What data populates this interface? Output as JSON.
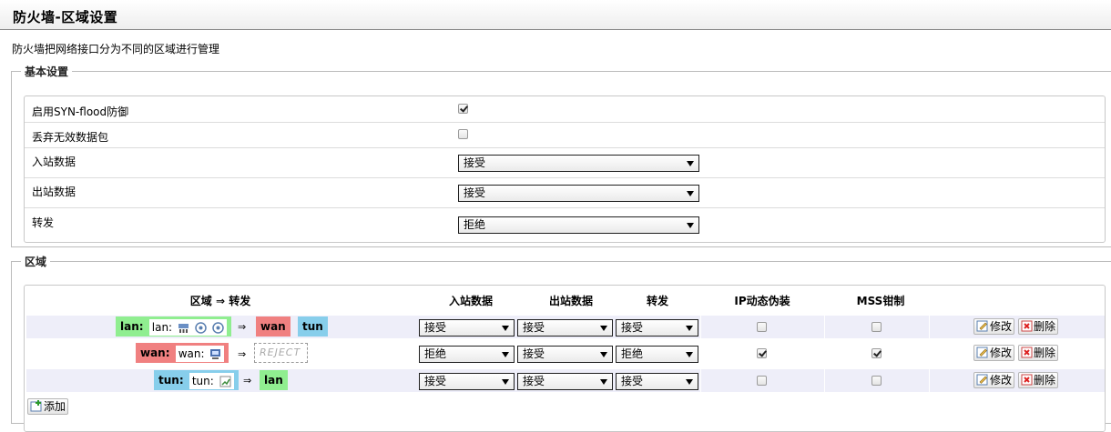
{
  "page": {
    "title": "防火墙-区域设置",
    "description": "防火墙把网络接口分为不同的区域进行管理"
  },
  "basic": {
    "legend": "基本设置",
    "syn_flood_label": "启用SYN-flood防御",
    "syn_flood_checked": true,
    "drop_invalid_label": "丢弃无效数据包",
    "drop_invalid_checked": false,
    "input_label": "入站数据",
    "input_value": "接受",
    "output_label": "出站数据",
    "output_value": "接受",
    "forward_label": "转发",
    "forward_value": "拒绝"
  },
  "zones": {
    "legend": "区域",
    "headers": {
      "zone": "区域 ⇒ 转发",
      "input": "入站数据",
      "output": "出站数据",
      "forward": "转发",
      "masq": "IP动态伪装",
      "mss": "MSS钳制"
    },
    "rows": [
      {
        "name": "lan:",
        "iface": "lan:",
        "icons": [
          "bridge-icon",
          "wifi-icon",
          "wifi-icon"
        ],
        "arrow": "⇒",
        "dests": [
          "wan",
          "tun"
        ],
        "input": "接受",
        "output": "接受",
        "forward": "接受",
        "masq": false,
        "mss": false
      },
      {
        "name": "wan:",
        "iface": "wan:",
        "icons": [
          "ethernet-icon"
        ],
        "arrow": "⇒",
        "dests": [
          "REJECT"
        ],
        "input": "拒绝",
        "output": "接受",
        "forward": "拒绝",
        "masq": true,
        "mss": true
      },
      {
        "name": "tun:",
        "iface": "tun:",
        "icons": [
          "tunnel-icon"
        ],
        "arrow": "⇒",
        "dests": [
          "lan"
        ],
        "input": "接受",
        "output": "接受",
        "forward": "接受",
        "masq": false,
        "mss": false
      }
    ],
    "edit_label": "修改",
    "delete_label": "删除",
    "add_label": "添加"
  },
  "colors": {
    "lan_zone": "#90ee90",
    "wan_zone": "#f08080",
    "tun_zone": "#87ceeb",
    "row_stripe": "#eeeef9"
  }
}
